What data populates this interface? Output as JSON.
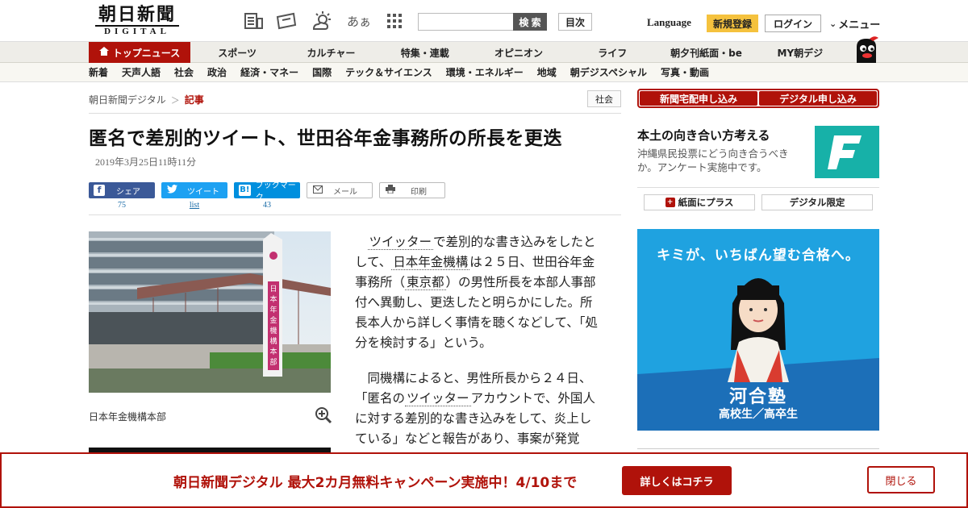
{
  "header": {
    "logo_main": "朝日新聞",
    "logo_sub": "DIGITAL",
    "font_toggle_label": "あぁ",
    "search_placeholder": "",
    "search_button": "検 索",
    "toc_button": "目次",
    "language_label": "Language",
    "register_button": "新規登録",
    "login_button": "ログイン",
    "menu_label": "メニュー",
    "icons": [
      "newspaper-icon",
      "ticket-icon",
      "weather-icon",
      "font-size-icon",
      "grid-icon"
    ]
  },
  "main_nav": [
    {
      "label": "トップニュース",
      "active": true
    },
    {
      "label": "スポーツ",
      "active": false
    },
    {
      "label": "カルチャー",
      "active": false
    },
    {
      "label": "特集・連載",
      "active": false
    },
    {
      "label": "オピニオン",
      "active": false
    },
    {
      "label": "ライフ",
      "active": false
    },
    {
      "label": "朝夕刊紙面・be",
      "active": false
    },
    {
      "label": "MY朝デジ",
      "active": false
    }
  ],
  "sub_nav": [
    "新着",
    "天声人語",
    "社会",
    "政治",
    "経済・マネー",
    "国際",
    "テック＆サイエンス",
    "環境・エネルギー",
    "地域",
    "朝デジスペシャル",
    "写真・動画"
  ],
  "breadcrumb": {
    "home": "朝日新聞デジタル",
    "separator": "＞",
    "current": "記事"
  },
  "category_tag": "社会",
  "article": {
    "headline": "匿名で差別的ツイート、世田谷年金事務所の所長を更迭",
    "date": "2019年3月25日11時11分",
    "share": {
      "facebook": {
        "label": "シェア",
        "count": "75"
      },
      "twitter": {
        "label": "ツイート",
        "count": "list"
      },
      "hatena": {
        "label": "ブックマーク",
        "count": "43"
      },
      "mail": {
        "label": "メール"
      },
      "print": {
        "label": "印刷"
      }
    },
    "photo_caption": "日本年金機構本部",
    "photo_sign_text": "日本年金機構本部",
    "p1": {
      "kw1": "ツイッター",
      "t1": "で差別的な書き込みをしたとして、",
      "kw2": "日本年金機構",
      "t2": "は２５日、世田谷年金事務所（",
      "kw3": "東京都",
      "t3": "）の男性所長を本部人事部付へ異動し、更迭したと明らかにした。所長本人から詳しく事情を聴くなどして、「処分を検討する」という。"
    },
    "p2": {
      "t1": "同機構によると、男性所長から２４日、「匿名の",
      "kw1": "ツイッター",
      "t2": "アカウントで、外国人に対する差別的な書き込みをして、炎上している」などと報告があり、事案が発覚"
    }
  },
  "right_column": {
    "btn_delivery": "新聞宅配申し込み",
    "btn_digital": "デジタル申し込み",
    "promo_title": "本土の向き合い方考える",
    "promo_desc": "沖縄県民投票にどう向き合うべきか。アンケート実施中です。",
    "btn_paper_plus": "紙面にプラス",
    "btn_digital_only": "デジタル限定",
    "ad": {
      "headline": "キミが、いちばん望む合格へ。",
      "brand": "河合塾",
      "sub": "高校生／高卒生"
    }
  },
  "banner": {
    "text": "朝日新聞デジタル 最大2カ月無料キャンペーン実施中！4/10まで",
    "cta": "詳しくはコチラ",
    "close": "閉じる"
  },
  "colors": {
    "brand_red": "#b0120a",
    "register_yellow": "#f5c23e",
    "facebook": "#3b5998",
    "twitter": "#1da1f2",
    "hatena": "#008fde",
    "promo_teal": "#17b1a8",
    "ad_blue": "#1fa2e0"
  }
}
